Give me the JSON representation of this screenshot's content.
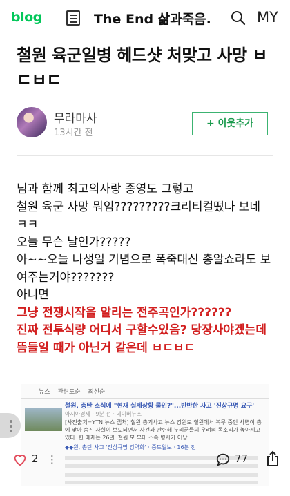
{
  "header": {
    "logo": "blog",
    "blog_title": "The End 삶과죽음..",
    "my_label": "MY"
  },
  "post": {
    "title": "철원 육군일병 헤드샷 처맞고 사망 ㅂㄷㅂㄷ",
    "author": "무라마사",
    "time": "13시간 전",
    "follow_label": "+ 이웃추가"
  },
  "body": {
    "line1": "님과 함께 최고의사랑 종영도 그렇고",
    "line2": "철원 육군 사망 뭐임?????????크리티컬떴나 보네 ㅋㅋ",
    "line3": "오늘 무슨 날인가?????",
    "line4": "아~~오늘 나생일 기념으로 폭죽대신 총알쇼라도 보여주는거야???????",
    "line5": "아니면",
    "red1": "그냥 전쟁시작을 알리는 전주곡인가??????",
    "red2": "진짜 전투식량 어디서 구할수있음? 당장사야겠는데",
    "red3": "뜸들일 때가 아닌거 같은데 ㅂㄷㅂㄷ"
  },
  "news": {
    "tabs": [
      "뉴스",
      "관련도순",
      "최신순"
    ],
    "headline": "철원, 총탄 소식에 \"현재 실제상황 물인?\"...반반한 사고 '진상규명 요구'",
    "meta": "아시아경제 · 9분 전 · 네이버뉴스",
    "desc": "[사진출처=YTN 뉴스 캡처] 철원 총기사고 뉴스 강원도 철원에서 복무 중인 사병이 총에 맞아 숨진 사실이 보도되면서 사건과 관련해 누리꾼들의 우려의 목소리가 높아지고 있다. 한 매체는 26일 '철원 모 부대 소속 병사가 어낭...",
    "headline2": "◆◆원, 총탄 사고 '진상규명 강력화' · 중도일보 · 16분 전"
  },
  "footer": {
    "like_count": "2",
    "more_label": "⋮",
    "comment_count": "77"
  },
  "colors": {
    "brand_green": "#03c75a",
    "emphasis_red": "#d21f1f"
  }
}
